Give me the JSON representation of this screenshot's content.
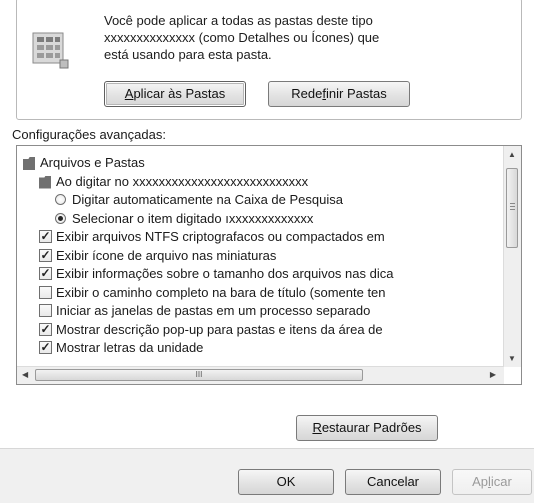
{
  "folder_view": {
    "description_lines": [
      "Você pode aplicar a todas as pastas deste tipo",
      "xxxxxxxxxxxxxx (como Detalhes ou Ícones) que",
      "está usando para esta pasta."
    ],
    "apply_button": {
      "prefix": "",
      "underline": "A",
      "rest": "plicar às Pastas"
    },
    "reset_button": {
      "prefix": "Rede",
      "underline": "f",
      "rest": "inir Pastas"
    }
  },
  "advanced": {
    "label": "Configurações avançadas:",
    "items": [
      {
        "type": "folder",
        "indent": 0,
        "label": "Arquivos e Pastas"
      },
      {
        "type": "folder",
        "indent": 1,
        "label": "Ao digitar no xxxxxxxxxxxxxxxxxxxxxxxxxxx"
      },
      {
        "type": "radio",
        "indent": 2,
        "checked": false,
        "label": "Digitar automaticamente na Caixa de Pesquisa"
      },
      {
        "type": "radio",
        "indent": 2,
        "checked": true,
        "label": "Selecionar o item digitado ıxxxxxxxxxxxxx"
      },
      {
        "type": "check",
        "indent": 1,
        "checked": true,
        "label": "Exibir arquivos NTFS criptografacos ou compactados em"
      },
      {
        "type": "check",
        "indent": 1,
        "checked": true,
        "label": "Exibir ícone de arquivo nas miniaturas"
      },
      {
        "type": "check",
        "indent": 1,
        "checked": true,
        "label": "Exibir informações sobre o tamanho dos arquivos nas dica"
      },
      {
        "type": "check",
        "indent": 1,
        "checked": false,
        "label": "Exibir o caminho completo na bara de título (somente ten"
      },
      {
        "type": "check",
        "indent": 1,
        "checked": false,
        "label": "Iniciar as janelas de pastas em um processo separado"
      },
      {
        "type": "check",
        "indent": 1,
        "checked": true,
        "label": "Mostrar descrição pop-up para pastas e itens da área de"
      },
      {
        "type": "check",
        "indent": 1,
        "checked": true,
        "label": "Mostrar letras da unidade"
      }
    ],
    "hscroll_thumb_grip": "III"
  },
  "restore_button": {
    "prefix": "",
    "underline": "R",
    "rest": "estaurar Padrões"
  },
  "footer": {
    "ok": "OK",
    "cancel": "Cancelar",
    "apply": {
      "prefix": "Ap",
      "underline": "l",
      "rest": "icar"
    }
  }
}
